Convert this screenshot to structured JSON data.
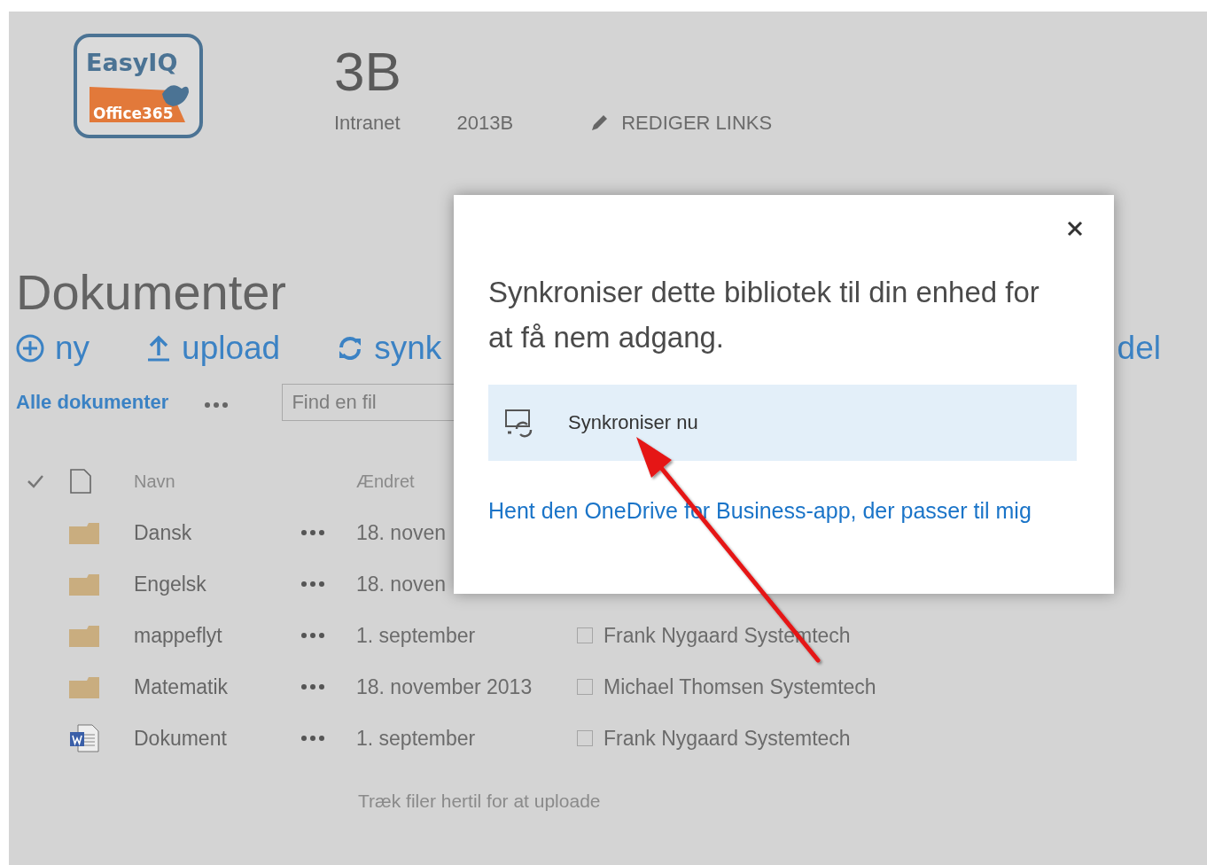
{
  "site": {
    "logo": {
      "wordmark": "EasyIQ",
      "band": "Office365"
    },
    "title": "3B",
    "nav": [
      {
        "label": "Intranet"
      },
      {
        "label": "2013B"
      }
    ],
    "edit_links": "REDIGER LINKS"
  },
  "library": {
    "title": "Dokumenter",
    "commands": [
      {
        "kind": "new",
        "label": "ny"
      },
      {
        "kind": "upload",
        "label": "upload"
      },
      {
        "kind": "sync",
        "label": "synk"
      },
      {
        "kind": "share",
        "label": "del"
      }
    ],
    "view": "Alle dokumenter",
    "search": {
      "placeholder": "Find en fil"
    },
    "columns": [
      "Navn",
      "Ændret"
    ],
    "rows": [
      {
        "kind": "folder",
        "name": "Dansk",
        "modified": "18. noven"
      },
      {
        "kind": "folder",
        "name": "Engelsk",
        "modified": "18. noven"
      },
      {
        "kind": "folder",
        "name": "mappeflyt",
        "modified": "1. september",
        "modified_by": "Frank Nygaard Systemtech"
      },
      {
        "kind": "folder",
        "name": "Matematik",
        "modified": "18. november 2013",
        "modified_by": "Michael Thomsen Systemtech"
      },
      {
        "kind": "word",
        "name": "Dokument",
        "modified": "1. september",
        "modified_by": "Frank Nygaard Systemtech"
      }
    ],
    "drop_hint": "Træk filer hertil for at uploade"
  },
  "dialog": {
    "message": "Synkroniser dette bibliotek til din enhed for at få nem adgang.",
    "action": "Synkroniser nu",
    "link": "Hent den OneDrive for Business-app, der passer til mig"
  }
}
